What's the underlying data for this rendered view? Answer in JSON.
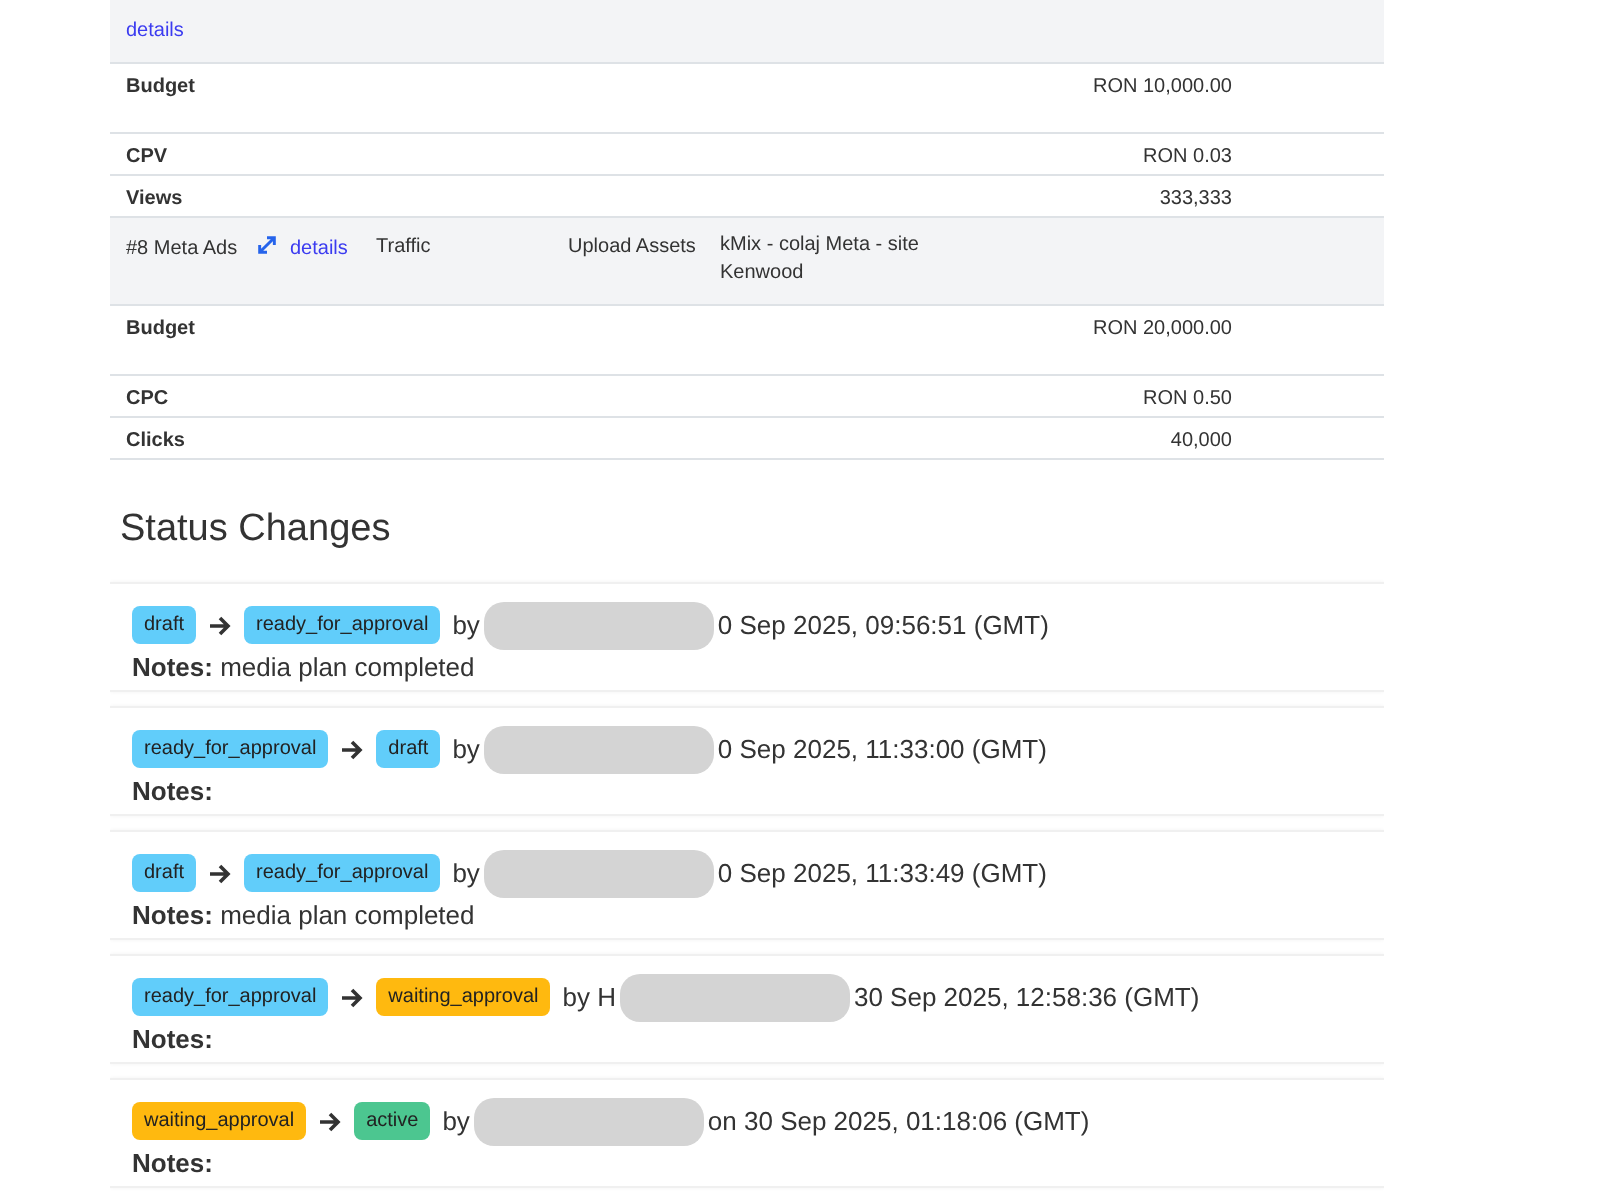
{
  "table": {
    "rows": [
      {
        "kind": "campaign",
        "link": "details"
      },
      {
        "kind": "budget",
        "label": "Budget",
        "value": "RON 10,000.00"
      },
      {
        "kind": "metric",
        "label": "CPV",
        "value": "RON 0.03"
      },
      {
        "kind": "metric",
        "label": "Views",
        "value": "333,333"
      },
      {
        "kind": "campaign",
        "name": "#8 Meta Ads",
        "link": "details",
        "objective": "Traffic",
        "action": "Upload Assets",
        "creative": "kMix - colaj Meta - site Kenwood"
      },
      {
        "kind": "budget",
        "label": "Budget",
        "value": "RON 20,000.00"
      },
      {
        "kind": "metric",
        "label": "CPC",
        "value": "RON 0.50"
      },
      {
        "kind": "metric",
        "label": "Clicks",
        "value": "40,000"
      }
    ]
  },
  "status_changes": {
    "title": "Status Changes",
    "items": [
      {
        "from": {
          "label": "draft",
          "color": "#61cdfa"
        },
        "to": {
          "label": "ready_for_approval",
          "color": "#61cdfa"
        },
        "by": "by",
        "time": "0 Sep 2025, 09:56:51 (GMT)",
        "notes_label": "Notes:",
        "notes": "media plan completed"
      },
      {
        "from": {
          "label": "ready_for_approval",
          "color": "#61cdfa"
        },
        "to": {
          "label": "draft",
          "color": "#61cdfa"
        },
        "by": "by",
        "time": "0 Sep 2025, 11:33:00 (GMT)",
        "notes_label": "Notes:"
      },
      {
        "from": {
          "label": "draft",
          "color": "#61cdfa"
        },
        "to": {
          "label": "ready_for_approval",
          "color": "#61cdfa"
        },
        "by": "by",
        "time": "0 Sep 2025, 11:33:49 (GMT)",
        "notes_label": "Notes:",
        "notes": "media plan completed"
      },
      {
        "from": {
          "label": "ready_for_approval",
          "color": "#61cdfa"
        },
        "to": {
          "label": "waiting_approval",
          "color": "#ffb90f"
        },
        "by": "by H",
        "time": "30 Sep 2025, 12:58:36 (GMT)",
        "notes_label": "Notes:"
      },
      {
        "from": {
          "label": "waiting_approval",
          "color": "#ffb90f"
        },
        "to": {
          "label": "active",
          "color": "#4cc690"
        },
        "by": "by",
        "time": "on 30 Sep 2025, 01:18:06 (GMT)",
        "notes_label": "Notes:"
      }
    ]
  }
}
